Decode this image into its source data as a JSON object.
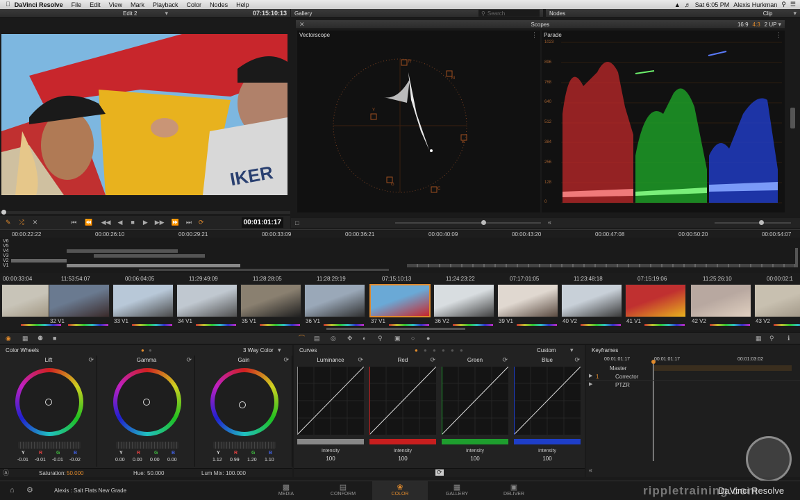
{
  "menubar": {
    "app": "DaVinci Resolve",
    "items": [
      "File",
      "Edit",
      "View",
      "Mark",
      "Playback",
      "Color",
      "Nodes",
      "Help"
    ],
    "clock": "Sat 6:05 PM",
    "user": "Alexis Hurkman"
  },
  "viewer": {
    "timeline_name": "Edit 2",
    "timecode": "07:15:10:13",
    "playhead_tc": "00:01:01:17"
  },
  "gallery": {
    "title": "Gallery",
    "search_placeholder": "Search"
  },
  "nodes": {
    "title": "Nodes",
    "mode": "Clip"
  },
  "scopes": {
    "title": "Scopes",
    "ratio1": "16:9",
    "ratio2": "4:3",
    "layout": "2 UP",
    "vectorscope_label": "Vectorscope",
    "parade_label": "Parade",
    "parade_ticks": [
      "1023",
      "896",
      "768",
      "640",
      "512",
      "384",
      "256",
      "128",
      "0"
    ],
    "vs_targets": [
      "R",
      "M",
      "B",
      "C",
      "G",
      "Y"
    ]
  },
  "timeline": {
    "ruler": [
      "00:00:22:22",
      "00:00:26:10",
      "00:00:29:21",
      "00:00:33:09",
      "00:00:36:21",
      "00:00:40:09",
      "00:00:43:20",
      "00:00:47:08",
      "00:00:50:20",
      "00:00:54:07"
    ],
    "tracks": [
      "V6",
      "V5",
      "V4",
      "V3",
      "V2",
      "V1"
    ]
  },
  "clips": [
    {
      "tc": "00:00:33:04",
      "label": ""
    },
    {
      "tc": "11:53:54:07",
      "label": "32 V1"
    },
    {
      "tc": "00:06:04:05",
      "label": "33 V1"
    },
    {
      "tc": "11:29:49:09",
      "label": "34 V1"
    },
    {
      "tc": "11:28:28:05",
      "label": "35 V1"
    },
    {
      "tc": "11:28:29:19",
      "label": "36 V1"
    },
    {
      "tc": "07:15:10:13",
      "label": "37 V1"
    },
    {
      "tc": "11:24:23:22",
      "label": "36 V2"
    },
    {
      "tc": "07:17:01:05",
      "label": "39 V1"
    },
    {
      "tc": "11:23:48:18",
      "label": "40 V2"
    },
    {
      "tc": "07:15:19:06",
      "label": "41 V1"
    },
    {
      "tc": "11:25:26:10",
      "label": "42 V2"
    },
    {
      "tc": "00:00:02:1",
      "label": "43 V2"
    }
  ],
  "color_wheels": {
    "title": "Color Wheels",
    "mode": "3 Way Color",
    "wheels": [
      {
        "name": "Lift",
        "y": "-0.01",
        "r": "-0.01",
        "g": "-0.01",
        "b": "-0.02"
      },
      {
        "name": "Gamma",
        "y": "0.00",
        "r": "0.00",
        "g": "0.00",
        "b": "0.00"
      },
      {
        "name": "Gain",
        "y": "1.12",
        "r": "0.99",
        "g": "1.20",
        "b": "1.10"
      }
    ],
    "saturation_label": "Saturation:",
    "saturation": "50.000",
    "hue_label": "Hue:",
    "hue": "50.000",
    "lummix_label": "Lum Mix:",
    "lummix": "100.000",
    "channel_letters": [
      "Y",
      "R",
      "G",
      "B"
    ]
  },
  "curves": {
    "title": "Curves",
    "mode": "Custom",
    "channels": [
      {
        "name": "Luminance",
        "intensity_label": "Intensity",
        "intensity": "100",
        "color": "#888888"
      },
      {
        "name": "Red",
        "intensity_label": "Intensity",
        "intensity": "100",
        "color": "#c81e1e"
      },
      {
        "name": "Green",
        "intensity_label": "Intensity",
        "intensity": "100",
        "color": "#1e9e2e"
      },
      {
        "name": "Blue",
        "intensity_label": "Intensity",
        "intensity": "100",
        "color": "#1e3ec8"
      }
    ]
  },
  "keyframes": {
    "title": "Keyframes",
    "tc1": "00:01:01:17",
    "tc2": "00:01:01:17",
    "tc3": "00:01:03:02",
    "rows": [
      "Master",
      "Corrector",
      "PTZR"
    ],
    "row_num": "1"
  },
  "footer": {
    "project": "Alexis : Salt Flats New Grade",
    "pages": [
      "MEDIA",
      "CONFORM",
      "COLOR",
      "GALLERY",
      "DELIVER"
    ],
    "active": "COLOR"
  },
  "watermark": {
    "text": "rippletraining.com",
    "overlay": "DaVinci Resolve"
  },
  "colors": {
    "accent": "#e08a2c",
    "panel": "#262626"
  }
}
